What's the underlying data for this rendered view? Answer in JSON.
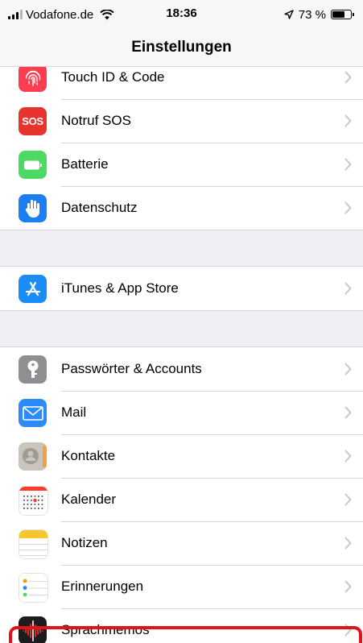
{
  "status_bar": {
    "carrier": "Vodafone.de",
    "time": "18:36",
    "battery_text": "73 %",
    "battery_level": 0.73
  },
  "nav": {
    "title": "Einstellungen"
  },
  "groups": [
    {
      "items": [
        {
          "label": "Touch ID & Code",
          "icon": "fingerprint-icon",
          "color": "#fd3c52"
        },
        {
          "label": "Notruf SOS",
          "icon": "sos-icon",
          "color": "#e8342f",
          "icon_text": "SOS"
        },
        {
          "label": "Batterie",
          "icon": "battery-icon",
          "color": "#4cd964"
        },
        {
          "label": "Datenschutz",
          "icon": "hand-icon",
          "color": "#1c7ff1"
        }
      ]
    },
    {
      "items": [
        {
          "label": "iTunes & App Store",
          "icon": "app-store-icon",
          "color": "#1a8cf5"
        }
      ]
    },
    {
      "items": [
        {
          "label": "Passwörter & Accounts",
          "icon": "key-icon",
          "color": "#8e8e93",
          "highlighted": true
        },
        {
          "label": "Mail",
          "icon": "mail-icon",
          "color": "#2b8cf7"
        },
        {
          "label": "Kontakte",
          "icon": "contacts-icon",
          "color": "#b8b4ad"
        },
        {
          "label": "Kalender",
          "icon": "calendar-icon",
          "color": "#ffffff"
        },
        {
          "label": "Notizen",
          "icon": "notes-icon",
          "color": "#ffffff"
        },
        {
          "label": "Erinnerungen",
          "icon": "reminders-icon",
          "color": "#ffffff"
        },
        {
          "label": "Sprachmemos",
          "icon": "voice-memos-icon",
          "color": "#1c1c1e"
        }
      ]
    }
  ]
}
